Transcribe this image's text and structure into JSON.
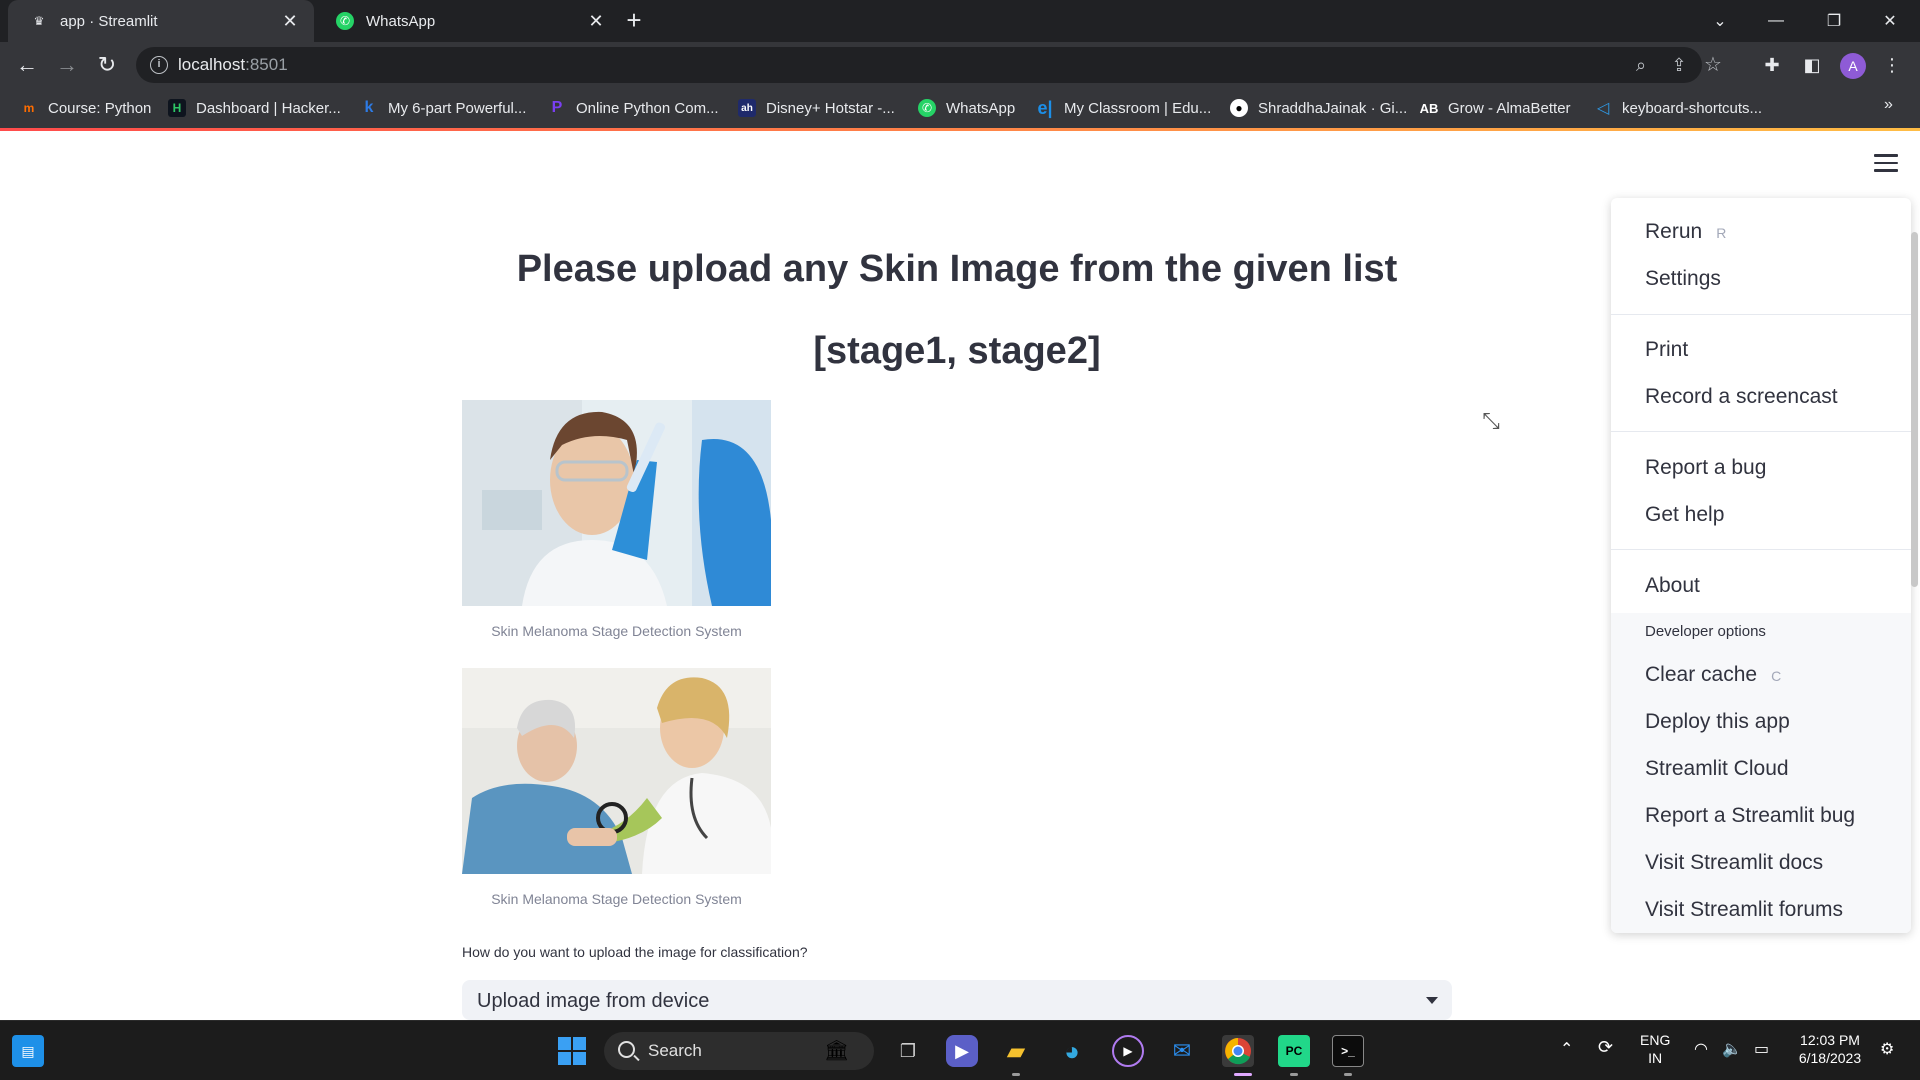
{
  "browser": {
    "tabs": [
      {
        "title": "app · Streamlit",
        "active": true
      },
      {
        "title": "WhatsApp",
        "active": false
      }
    ],
    "url_host": "localhost",
    "url_port": ":8501",
    "profile_initial": "A"
  },
  "bookmarks": [
    {
      "label": "Course: Python",
      "icon": "coursera-icon"
    },
    {
      "label": "Dashboard | Hacker...",
      "icon": "hackerrank-icon"
    },
    {
      "label": "My 6-part Powerful...",
      "icon": "k-icon"
    },
    {
      "label": "Online Python Com...",
      "icon": "programiz-icon"
    },
    {
      "label": "Disney+ Hotstar -...",
      "icon": "hotstar-icon"
    },
    {
      "label": "WhatsApp",
      "icon": "whatsapp-icon"
    },
    {
      "label": "My Classroom | Edu...",
      "icon": "edureka-icon"
    },
    {
      "label": "ShraddhaJainak · Gi...",
      "icon": "github-icon"
    },
    {
      "label": "Grow - AlmaBetter",
      "icon": "almabetter-icon"
    },
    {
      "label": "keyboard-shortcuts...",
      "icon": "vscode-icon"
    }
  ],
  "main": {
    "title": "Please upload any Skin Image from the given list",
    "subtitle": "[stage1, stage2]",
    "images": [
      {
        "caption": "Skin Melanoma Stage Detection System"
      },
      {
        "caption": "Skin Melanoma Stage Detection System"
      }
    ],
    "select_label": "How do you want to upload the image for classification?",
    "select_value": "Upload image from device"
  },
  "menu": {
    "rerun": "Rerun",
    "rerun_key": "R",
    "settings": "Settings",
    "print": "Print",
    "record": "Record a screencast",
    "report_bug": "Report a bug",
    "get_help": "Get help",
    "about": "About",
    "dev_label": "Developer options",
    "clear_cache": "Clear cache",
    "clear_cache_key": "C",
    "deploy": "Deploy this app",
    "cloud": "Streamlit Cloud",
    "report_st_bug": "Report a Streamlit bug",
    "docs": "Visit Streamlit docs",
    "forums": "Visit Streamlit forums"
  },
  "taskbar": {
    "search_label": "Search",
    "lang_line1": "ENG",
    "lang_line2": "IN",
    "time": "12:03 PM",
    "date": "6/18/2023"
  },
  "colors": {
    "streamlit_red": "#ff4b4b",
    "text": "#31333f",
    "chrome_dark": "#202124",
    "chrome_mid": "#35363a"
  }
}
